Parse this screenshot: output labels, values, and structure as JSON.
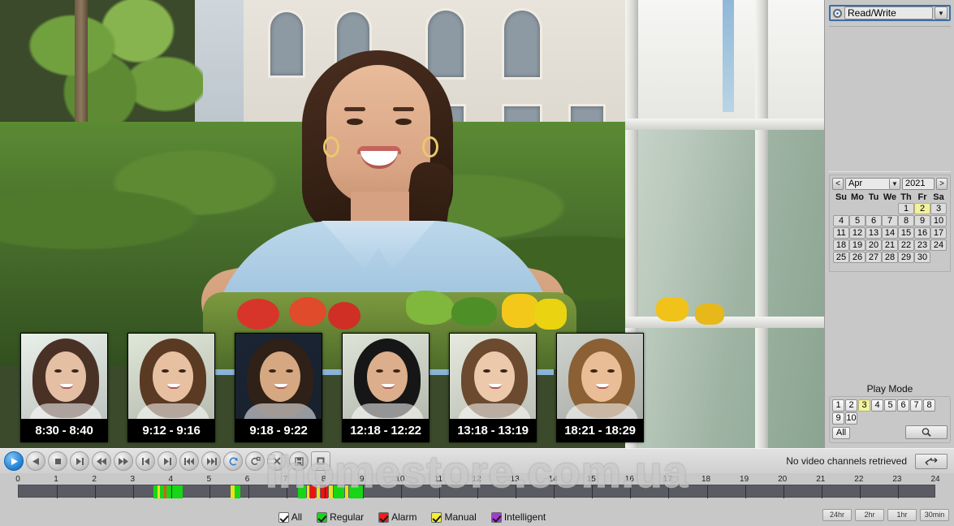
{
  "right_panel": {
    "mode_select": {
      "value": "Read/Write",
      "radio_icon": "radio-selected",
      "arrow_icon": "chevron-down-icon"
    },
    "calendar": {
      "prev_label": "<",
      "next_label": ">",
      "month": "Apr",
      "year": "2021",
      "dow": [
        "Su",
        "Mo",
        "Tu",
        "We",
        "Th",
        "Fr",
        "Sa"
      ],
      "lead_blanks": 4,
      "days": [
        1,
        2,
        3,
        4,
        5,
        6,
        7,
        8,
        9,
        10,
        11,
        12,
        13,
        14,
        15,
        16,
        17,
        18,
        19,
        20,
        21,
        22,
        23,
        24,
        25,
        26,
        27,
        28,
        29,
        30
      ],
      "selected_day": 2
    },
    "play_mode": {
      "title": "Play Mode",
      "channels": [
        "1",
        "2",
        "3",
        "4",
        "5",
        "6",
        "7",
        "8",
        "9",
        "10"
      ],
      "selected_channel": "3",
      "all_label": "All",
      "search_icon": "magnifier-icon"
    }
  },
  "thumbnails": [
    {
      "time": "8:30 - 8:40",
      "hair": "#4a3126",
      "skin": "#e4bfa4",
      "bg": "#e9f0ea"
    },
    {
      "time": "9:12 - 9:16",
      "hair": "#5b3a23",
      "skin": "#e7c0a2",
      "bg": "#dfe7d8"
    },
    {
      "time": "9:18 - 9:22",
      "hair": "#2f2018",
      "skin": "#d5a882",
      "bg": "#1a2433"
    },
    {
      "time": "12:18 - 12:22",
      "hair": "#161616",
      "skin": "#dcae8b",
      "bg": "#dde3d6"
    },
    {
      "time": "13:18 - 13:19",
      "hair": "#6b4a30",
      "skin": "#ecc9ab",
      "bg": "#e6eade"
    },
    {
      "time": "18:21 - 18:29",
      "hair": "#8a6034",
      "skin": "#e9bd96",
      "bg": "#cfd3cd"
    }
  ],
  "controls": {
    "buttons": [
      {
        "name": "play-button",
        "icon": "play",
        "state": "primary"
      },
      {
        "name": "reverse-play-button",
        "icon": "play-reverse",
        "state": "normal"
      },
      {
        "name": "stop-button",
        "icon": "stop",
        "state": "normal"
      },
      {
        "name": "slow-play-button",
        "icon": "slow-play",
        "state": "normal"
      },
      {
        "name": "rewind-button",
        "icon": "rewind",
        "state": "normal"
      },
      {
        "name": "fast-forward-button",
        "icon": "fast-forward",
        "state": "normal"
      },
      {
        "name": "previous-frame-button",
        "icon": "prev-frame",
        "state": "normal"
      },
      {
        "name": "next-frame-button",
        "icon": "next-frame",
        "state": "normal"
      },
      {
        "name": "previous-file-button",
        "icon": "prev-file",
        "state": "normal"
      },
      {
        "name": "next-file-button",
        "icon": "next-file",
        "state": "normal"
      },
      {
        "name": "sync-loop-button",
        "icon": "loop",
        "state": "active"
      },
      {
        "name": "clip-button",
        "icon": "clip",
        "state": "normal"
      },
      {
        "name": "close-all-button",
        "icon": "close-x",
        "state": "normal"
      },
      {
        "name": "save-button",
        "icon": "save-disk",
        "state": "normal"
      },
      {
        "name": "snapshot-button",
        "icon": "snapshot",
        "state": "square"
      }
    ],
    "status_text": "No video channels retrieved",
    "refresh_icon": "refresh-arrows"
  },
  "timeline": {
    "hour_labels": [
      "0",
      "1",
      "2",
      "3",
      "4",
      "5",
      "6",
      "7",
      "8",
      "9",
      "10",
      "11",
      "12",
      "13",
      "14",
      "15",
      "16",
      "17",
      "18",
      "19",
      "20",
      "21",
      "22",
      "23",
      "24"
    ],
    "range_start_hour": 0,
    "range_end_hour": 24,
    "track_color": "#5b5b63",
    "segments": [
      {
        "start": 3.53,
        "end": 3.64,
        "type": "Regular",
        "color": "#16d616"
      },
      {
        "start": 3.64,
        "end": 3.7,
        "type": "Manual",
        "color": "#e8e21c"
      },
      {
        "start": 3.7,
        "end": 3.8,
        "type": "Regular",
        "color": "#16d616"
      },
      {
        "start": 3.8,
        "end": 3.86,
        "type": "Alarm",
        "color": "#d85a1e"
      },
      {
        "start": 3.86,
        "end": 4.3,
        "type": "Regular",
        "color": "#16d616"
      },
      {
        "start": 5.55,
        "end": 5.66,
        "type": "Manual",
        "color": "#e8e21c"
      },
      {
        "start": 5.66,
        "end": 5.8,
        "type": "Regular",
        "color": "#16d616"
      },
      {
        "start": 7.3,
        "end": 7.52,
        "type": "Regular",
        "color": "#16d616"
      },
      {
        "start": 7.55,
        "end": 7.6,
        "type": "Manual",
        "color": "#e8e21c"
      },
      {
        "start": 7.62,
        "end": 7.76,
        "type": "Alarm",
        "color": "#f01010"
      },
      {
        "start": 7.8,
        "end": 7.88,
        "type": "Manual",
        "color": "#e8e21c"
      },
      {
        "start": 7.9,
        "end": 8.1,
        "type": "Alarm",
        "color": "#f01010"
      },
      {
        "start": 8.12,
        "end": 8.22,
        "type": "Manual",
        "color": "#e8e21c"
      },
      {
        "start": 8.24,
        "end": 8.52,
        "type": "Regular",
        "color": "#16d616"
      },
      {
        "start": 8.54,
        "end": 8.62,
        "type": "Manual",
        "color": "#e8e21c"
      },
      {
        "start": 8.64,
        "end": 9.0,
        "type": "Regular",
        "color": "#16d616"
      }
    ],
    "legend": [
      {
        "label": "All",
        "color": "#ffffff"
      },
      {
        "label": "Regular",
        "color": "#19d419"
      },
      {
        "label": "Alarm",
        "color": "#ee1c1c"
      },
      {
        "label": "Manual",
        "color": "#f2ee3a"
      },
      {
        "label": "Intelligent",
        "color": "#a23bd6"
      }
    ],
    "zoom_buttons": [
      "24hr",
      "2hr",
      "1hr",
      "30min"
    ]
  },
  "watermark": {
    "text": "ihomestore.com.ua"
  }
}
